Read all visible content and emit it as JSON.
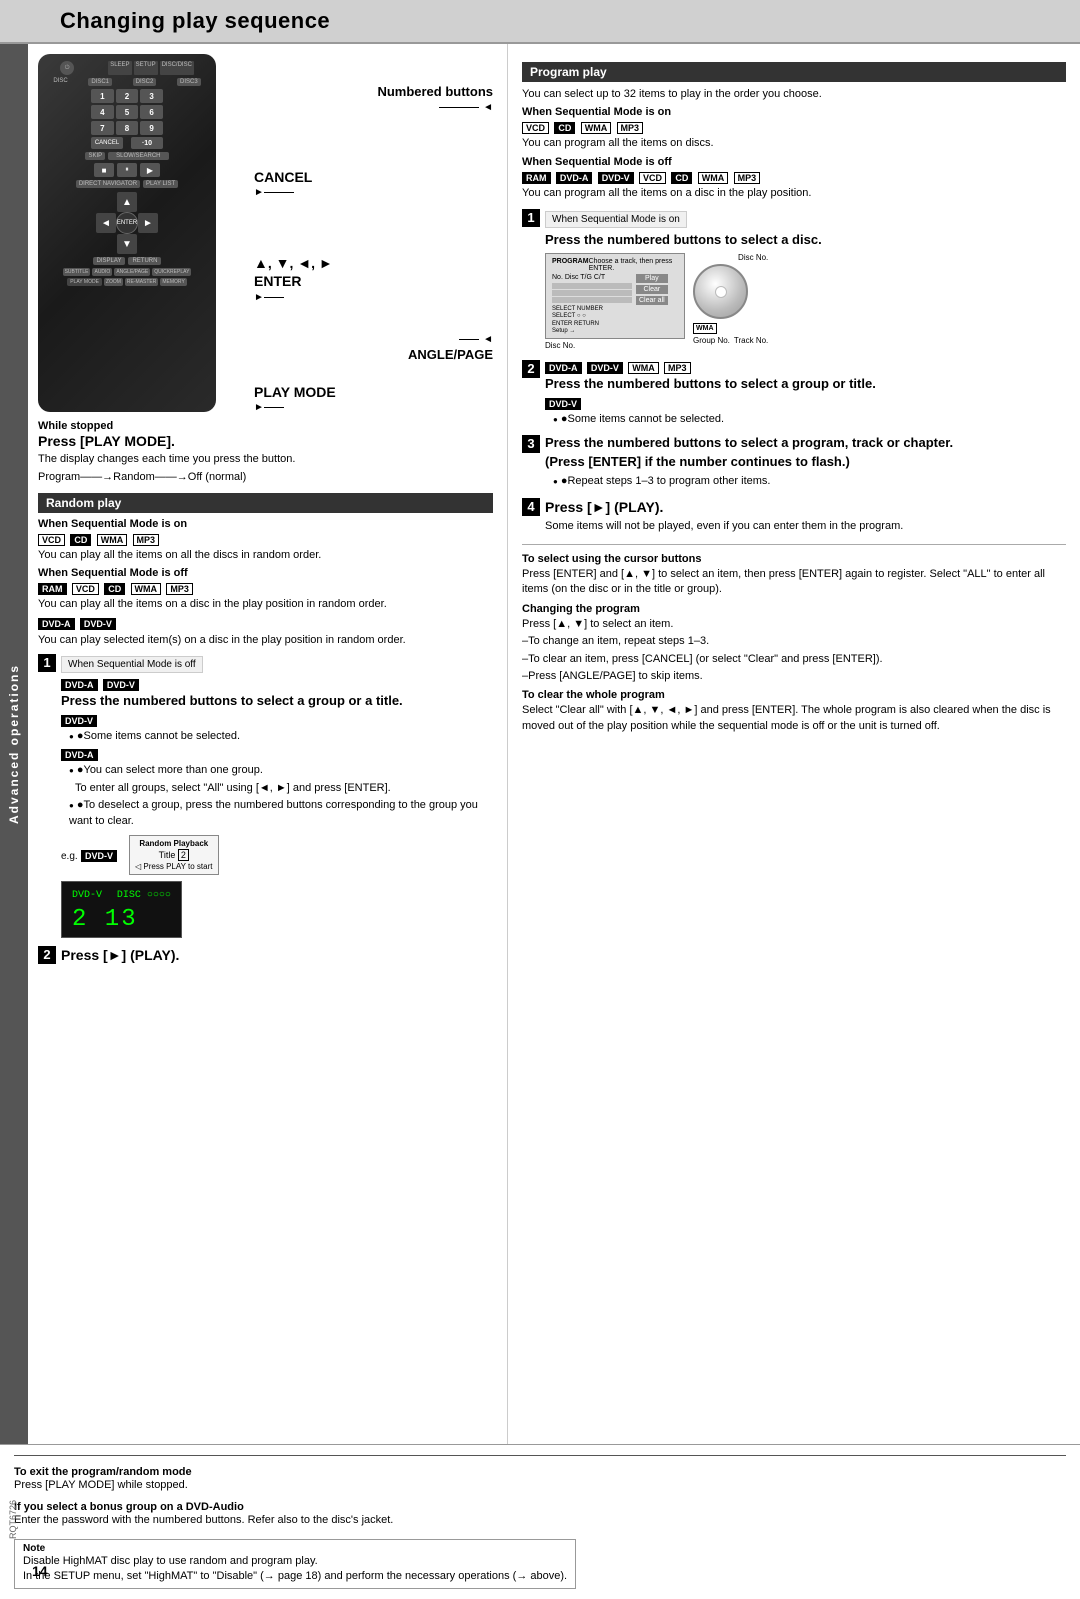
{
  "page": {
    "title": "Changing play sequence",
    "page_number": "14",
    "rqt_number": "RQT6726",
    "side_label": "Advanced operations"
  },
  "remote": {
    "buttons": {
      "cancel_label": "CANCEL",
      "enter_label": "ENTER",
      "play_mode_label": "PLAY MODE",
      "angle_page_label": "ANGLE/PAGE",
      "numbered_buttons_label": "Numbered buttons",
      "numbered_buttons_desc": "▲, ▼, ◄, ►"
    }
  },
  "random_play": {
    "section_title": "Random play",
    "when_seq_on_label": "When Sequential Mode is on",
    "when_seq_on_badges": "VCD  CD  WMA  MP3",
    "when_seq_on_desc": "You can play all the items on all the discs in random order.",
    "when_seq_off_label": "When Sequential Mode is off",
    "when_seq_off_badges": "RAM  VCD  CD  WMA  MP3",
    "when_seq_off_desc": "You can play all the items on a disc in the play position in random order.",
    "dvd_av_label": "DVD-A  DVD-V",
    "dvd_av_desc": "You can play selected item(s) on a disc in the play position in random order.",
    "step1_header": "When Sequential Mode is off",
    "step1_badges": "DVD-A  DVD-V",
    "step1_instruction": "Press the numbered buttons to select a group or a title.",
    "step1_dvdv_label": "DVD-V",
    "step1_dvdv_note": "●Some items cannot be selected.",
    "step1_dvda_label": "DVD-A",
    "step1_dvda_note1": "●You can select more than one group.",
    "step1_dvda_note2": "To enter all groups, select \"All\" using [◄, ►] and press [ENTER].",
    "step1_dvda_note3": "●To deselect a group, press the numbered buttons corresponding to the group you want to clear.",
    "step2_instruction": "Press [►] (PLAY).",
    "while_stopped": "While stopped",
    "press_play_mode": "Press [PLAY MODE].",
    "play_mode_desc": "The display changes each time you press the button.",
    "program_flow": "Program——→Random——→Off (normal)"
  },
  "program_play": {
    "section_title": "Program play",
    "desc": "You can select up to 32 items to play in the order you choose.",
    "when_seq_on_label": "When Sequential Mode is on",
    "when_seq_on_badges": "VCD  CD  WMA  MP3",
    "when_seq_on_desc": "You can program all the items on discs.",
    "when_seq_off_label": "When Sequential Mode is off",
    "when_seq_off_badges": "RAM  DVD-A  DVD-V  VCD  CD  WMA  MP3",
    "when_seq_off_desc": "You can program all the items on a disc in the play position.",
    "step1_seq_label": "When Sequential Mode is on",
    "step1_instruction": "Press the numbered buttons to select a disc.",
    "disc_no_label": "Disc No.",
    "group_no_label": "Group No.",
    "track_no_label": "Track No.",
    "step2_badges": "DVD-A  DVD-V  WMA  MP3",
    "step2_instruction": "Press the numbered buttons to select a group or title.",
    "step2_dvdv_label": "DVD-V",
    "step2_dvdv_note": "●Some items cannot be selected.",
    "step3_instruction": "Press the numbered buttons to select a program, track or chapter.",
    "step3_enter_note": "(Press [ENTER] if the number continues to flash.)",
    "step3_repeat": "●Repeat steps 1–3 to program other items.",
    "step4_instruction": "Press [►] (PLAY).",
    "step4_note": "Some items will not be played, even if you can enter them in the program.",
    "select_cursor_title": "To select using the cursor buttons",
    "select_cursor_desc": "Press [ENTER] and [▲, ▼] to select an item, then press [ENTER] again to register. Select \"ALL\" to enter all items (on the disc or in the title or group).",
    "changing_program_title": "Changing the program",
    "changing_program_desc1": "Press [▲, ▼] to select an item.",
    "changing_program_desc2": "–To change an item, repeat steps 1–3.",
    "changing_program_desc3": "–To clear an item, press [CANCEL] (or select \"Clear\" and press [ENTER]).",
    "changing_program_desc4": "–Press [ANGLE/PAGE] to skip items.",
    "clear_program_title": "To clear the whole program",
    "clear_program_desc": "Select \"Clear all\" with [▲, ▼, ◄, ►] and press [ENTER]. The whole program is also cleared when the disc is moved out of the play position while the sequential mode is off or the unit is turned off."
  },
  "bottom_notes": {
    "exit_title": "To exit the program/random mode",
    "exit_desc": "Press [PLAY MODE] while stopped.",
    "bonus_title": "If you select a bonus group on a DVD-Audio",
    "bonus_desc": "Enter the password with the numbered buttons. Refer also to the disc's jacket.",
    "note_title": "Note",
    "note_line1": "Disable HighMAT disc play to use random and program play.",
    "note_line2": "In the SETUP menu, set \"HighMAT\" to \"Disable\" (→ page 18) and perform the necessary operations (→ above)."
  }
}
